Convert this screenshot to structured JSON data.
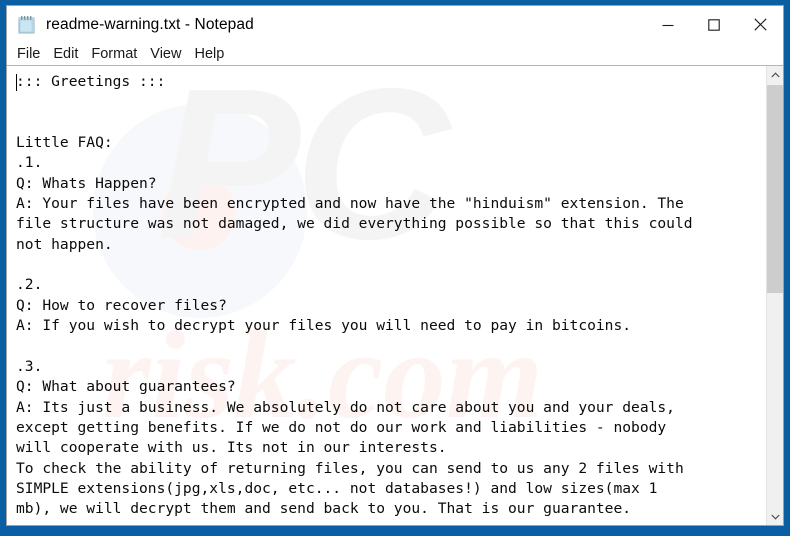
{
  "window": {
    "title": "readme-warning.txt - Notepad",
    "icon": "notepad-icon",
    "accent_color": "#0a5fa4",
    "background_color": "#ffffff"
  },
  "title_bar": {
    "minimize_label": "–",
    "maximize_label": "□",
    "close_label": "✕",
    "minimize_name": "minimize-button",
    "maximize_name": "maximize-button",
    "close_name": "close-button"
  },
  "menu_bar": {
    "items": [
      {
        "label": "File"
      },
      {
        "label": "Edit"
      },
      {
        "label": "Format"
      },
      {
        "label": "View"
      },
      {
        "label": "Help"
      }
    ]
  },
  "editor": {
    "text": "::: Greetings :::\n\n\nLittle FAQ:\n.1.\nQ: Whats Happen?\nA: Your files have been encrypted and now have the \"hinduism\" extension. The\nfile structure was not damaged, we did everything possible so that this could\nnot happen.\n\n.2.\nQ: How to recover files?\nA: If you wish to decrypt your files you will need to pay in bitcoins.\n\n.3.\nQ: What about guarantees?\nA: Its just a business. We absolutely do not care about you and your deals,\nexcept getting benefits. If we do not do our work and liabilities - nobody\nwill cooperate with us. Its not in our interests.\nTo check the ability of returning files, you can send to us any 2 files with\nSIMPLE extensions(jpg,xls,doc, etc... not databases!) and low sizes(max 1\nmb), we will decrypt them and send back to you. That is our guarantee.",
    "lines": [
      "::: Greetings :::",
      "",
      "",
      "Little FAQ:",
      ".1.",
      "Q: Whats Happen?",
      "A: Your files have been encrypted and now have the \"hinduism\" extension. The",
      "file structure was not damaged, we did everything possible so that this could",
      "not happen.",
      "",
      ".2.",
      "Q: How to recover files?",
      "A: If you wish to decrypt your files you will need to pay in bitcoins.",
      "",
      ".3.",
      "Q: What about guarantees?",
      "A: Its just a business. We absolutely do not care about you and your deals,",
      "except getting benefits. If we do not do our work and liabilities - nobody",
      "will cooperate with us. Its not in our interests.",
      "To check the ability of returning files, you can send to us any 2 files with",
      "SIMPLE extensions(jpg,xls,doc, etc... not databases!) and low sizes(max 1",
      "mb), we will decrypt them and send back to you. That is our guarantee."
    ],
    "caret_visible": true,
    "text_color": "#0b0b0b"
  },
  "scrollbar": {
    "up_arrow": "⌃",
    "down_arrow": "⌄",
    "thumb_color": "#cdcdcd",
    "track_color": "#f0f0f0"
  },
  "watermark": {
    "primary": "PC",
    "secondary": "risk.com"
  }
}
